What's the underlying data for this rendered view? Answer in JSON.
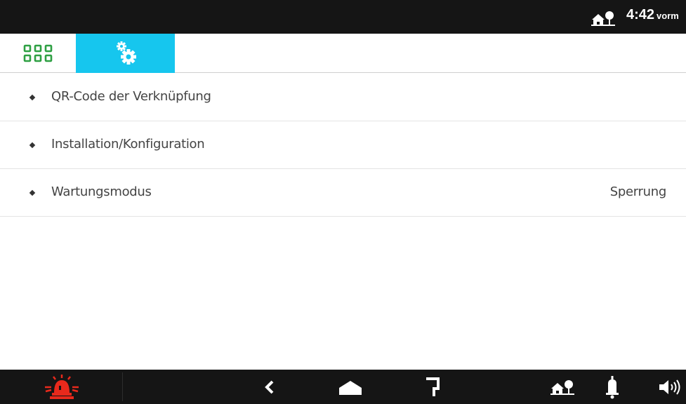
{
  "status_bar": {
    "time": "4:42",
    "time_suffix": "vorm"
  },
  "menu": {
    "items": [
      {
        "label": "QR-Code der Verknüpfung",
        "value": ""
      },
      {
        "label": "Installation/Konfiguration",
        "value": ""
      },
      {
        "label": "Wartungsmodus",
        "value": "Sperrung"
      }
    ]
  },
  "colors": {
    "accent": "#16c6ee",
    "apps_icon": "#2ea043",
    "alarm": "#e8291c",
    "bar": "#151515"
  },
  "icons": {
    "status_home": "home-trees-icon",
    "apps": "apps-grid-icon",
    "settings": "gears-icon",
    "alarm": "alarm-siren-icon",
    "back": "back-chevron-icon",
    "home": "home-icon",
    "recents": "recent-apps-icon",
    "house": "home-trees-icon",
    "bell": "bell-icon",
    "volume": "volume-icon"
  }
}
